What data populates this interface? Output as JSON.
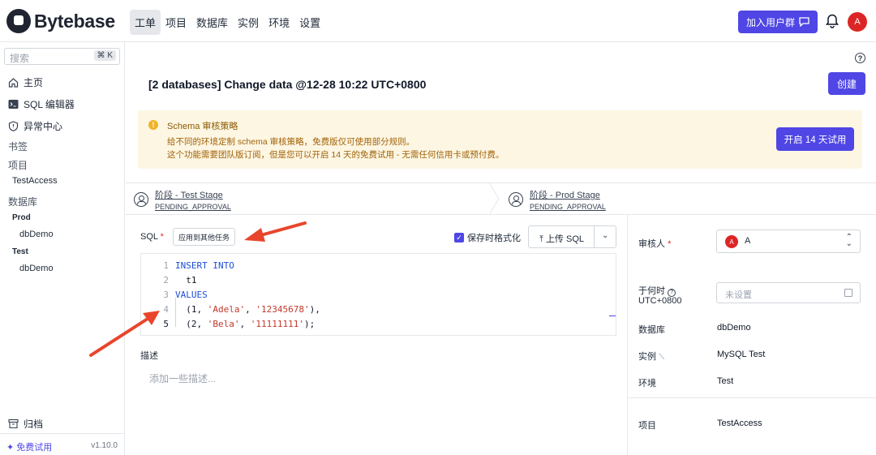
{
  "brand": {
    "name": "Bytebase"
  },
  "nav": [
    {
      "label": "工单",
      "active": true
    },
    {
      "label": "项目"
    },
    {
      "label": "数据库"
    },
    {
      "label": "实例"
    },
    {
      "label": "环境"
    },
    {
      "label": "设置"
    }
  ],
  "topbar": {
    "join_label": "加入用户群",
    "avatar_initial": "A"
  },
  "sidebar": {
    "search_placeholder": "搜索",
    "search_shortcut": "⌘ K",
    "home": "主页",
    "sql_editor": "SQL 编辑器",
    "anomaly": "异常中心",
    "bookmarks": "书签",
    "projects": "项目",
    "project_item": "TestAccess",
    "databases": "数据库",
    "env_prod": "Prod",
    "db_prod": "dbDemo",
    "env_test": "Test",
    "db_test": "dbDemo",
    "archive": "归档",
    "free_trial": "免费试用",
    "version": "v1.10.0"
  },
  "page": {
    "title": "[2 databases] Change data @12-28 10:22 UTC+0800",
    "create_label": "创建"
  },
  "banner": {
    "title": "Schema 审核策略",
    "line1": "给不同的环境定制 schema 审核策略，免费版仅可使用部分规则。",
    "line2": "这个功能需要团队版订阅，但是您可以开启 14 天的免费试用 - 无需任何信用卡或预付费。",
    "trial_label": "开启 14 天试用"
  },
  "stages": [
    {
      "name": "阶段 - Test Stage",
      "status": "PENDING_APPROVAL"
    },
    {
      "name": "阶段 - Prod Stage",
      "status": "PENDING_APPROVAL"
    }
  ],
  "sql": {
    "label": "SQL",
    "required_mark": "*",
    "apply_label": "应用到其他任务",
    "format_label": "保存时格式化",
    "format_checked": true,
    "upload_label": "上传 SQL",
    "line_numbers": [
      "1",
      "2",
      "3",
      "4",
      "5"
    ],
    "lines": [
      {
        "keyword": "INSERT INTO"
      },
      {
        "text": "  t1"
      },
      {
        "keyword": "VALUES"
      },
      {
        "p1": "  (1, ",
        "s1": "'Adela'",
        "p2": ", ",
        "s2": "'12345678'",
        "p3": "),"
      },
      {
        "p1": "  (2, ",
        "s1": "'Bela'",
        "p2": ", ",
        "s2": "'11111111'",
        "p3": ");"
      }
    ]
  },
  "description": {
    "label": "描述",
    "placeholder": "添加一些描述..."
  },
  "right_panel": {
    "reviewer_label": "审核人",
    "reviewer_required": "*",
    "reviewer_initial": "A",
    "reviewer_name": "A",
    "when_label": "于何时",
    "timezone": "UTC+0800",
    "when_placeholder": "未设置",
    "database_label": "数据库",
    "database_value": "dbDemo",
    "instance_label": "实例",
    "instance_value": "MySQL Test",
    "environment_label": "环境",
    "environment_value": "Test",
    "project_label": "项目",
    "project_value": "TestAccess"
  },
  "colors": {
    "accent": "#4f46e5",
    "annotation_arrow": "#e8452c",
    "banner_bg": "#fdf6e3"
  }
}
